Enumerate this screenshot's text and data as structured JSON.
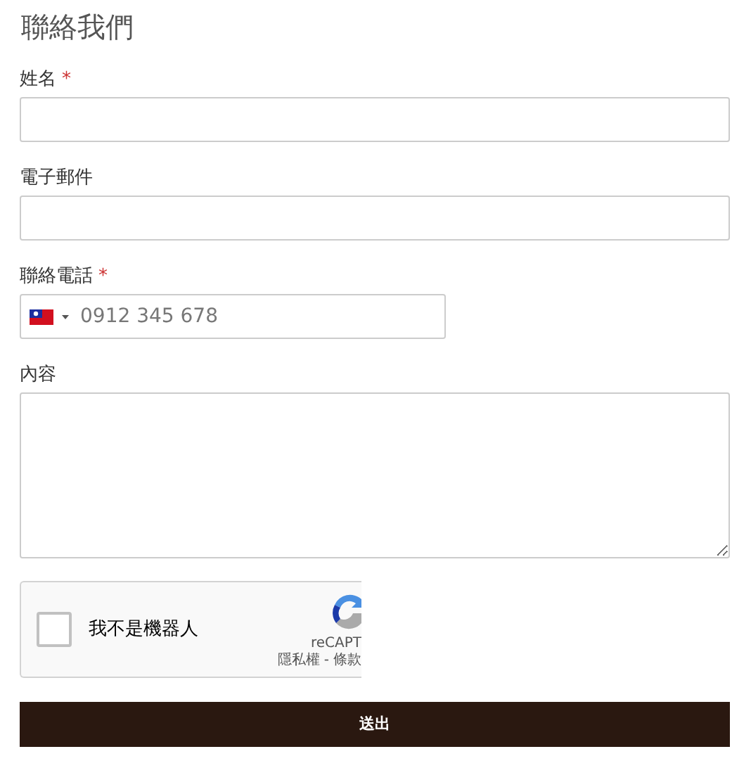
{
  "title": "聯絡我們",
  "fields": [
    {
      "kind": "text",
      "label": "姓名",
      "required_mark": "*"
    },
    {
      "kind": "text",
      "label": "電子郵件"
    },
    {
      "kind": "tel",
      "label": "聯絡電話",
      "required_mark": "*",
      "placeholder": "0912 345 678"
    },
    {
      "kind": "textarea",
      "label": "內容"
    }
  ],
  "recaptcha": {
    "checkbox_label": "我不是機器人",
    "checked": false,
    "brand": "reCAPT",
    "links": [
      "隱私權",
      "條款"
    ],
    "separator": "-"
  },
  "submit": "送出"
}
